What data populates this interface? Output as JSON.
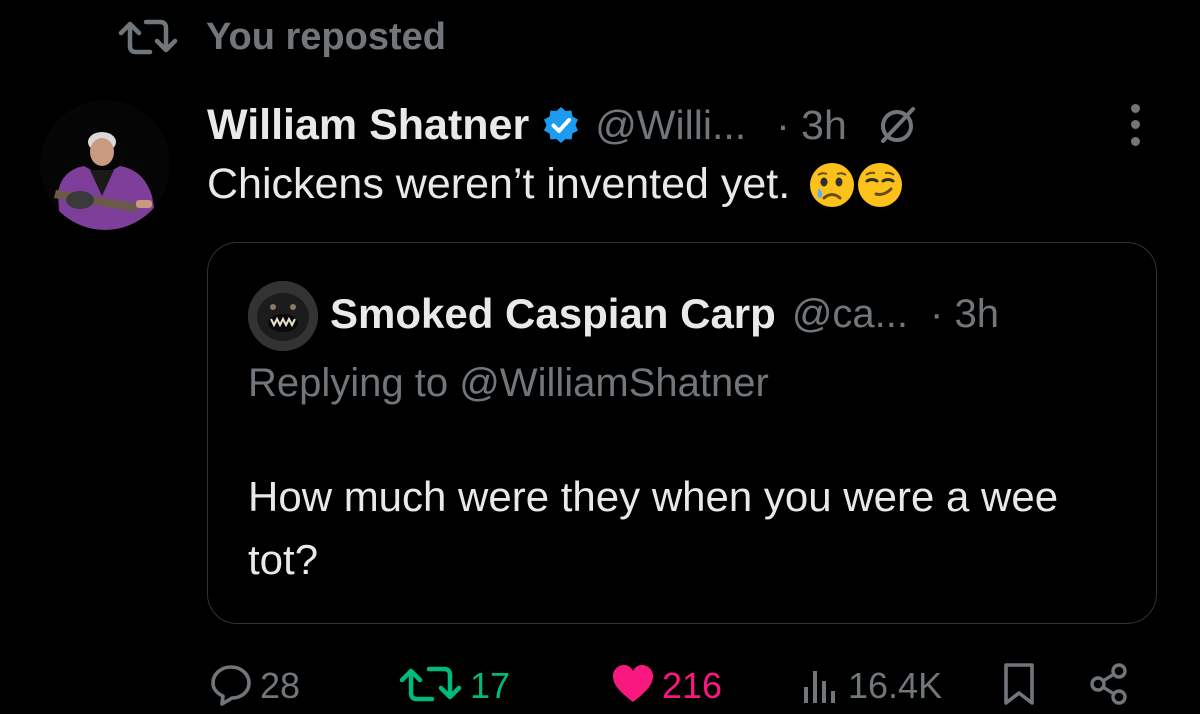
{
  "repost": {
    "label": "You reposted",
    "icon": "repost-icon"
  },
  "tweet": {
    "author_name": "William Shatner",
    "verified": true,
    "handle": "@Willi...",
    "time": "· 3h",
    "text": "Chickens weren’t invented yet.",
    "emojis": [
      "crying-face-emoji",
      "smirking-face-emoji"
    ]
  },
  "quote": {
    "author_name": "Smoked Caspian Carp",
    "handle": "@ca...",
    "time": "· 3h",
    "replying_prefix": "Replying to",
    "replying_handle": "@WilliamShatner",
    "text": "How much were they when you were a wee tot?"
  },
  "actions": {
    "replies": "28",
    "reposts": "17",
    "likes": "216",
    "views": "16.4K",
    "reposted": true,
    "liked": true
  },
  "colors": {
    "background": "#000000",
    "text": "#e7e9ea",
    "muted": "#71767b",
    "border": "#2f3336",
    "verified": "#1d9bf0",
    "repost_active": "#00ba7c",
    "like_active": "#f91880"
  }
}
